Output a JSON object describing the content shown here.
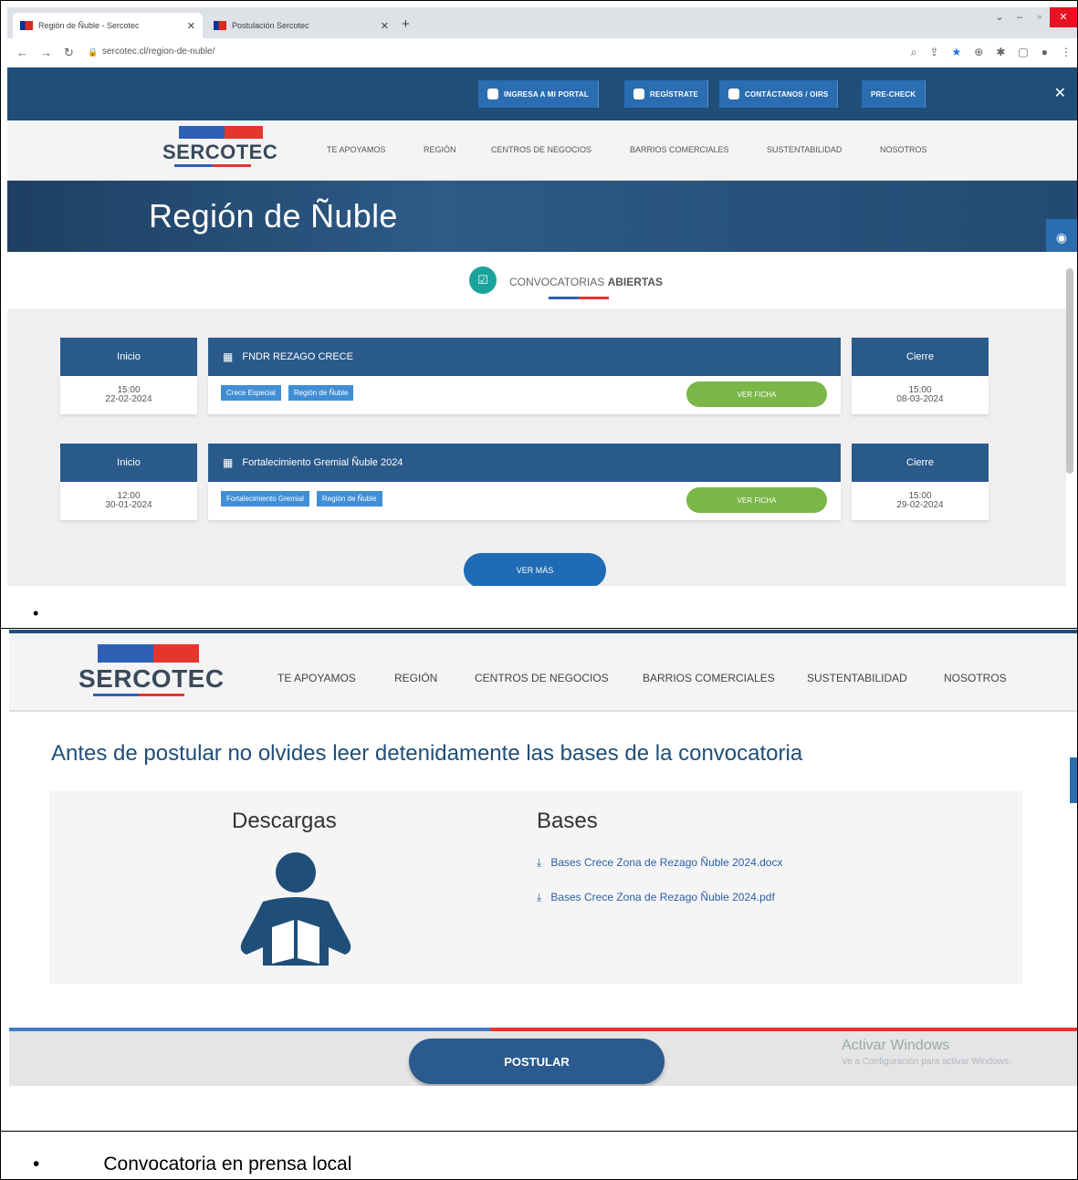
{
  "browser": {
    "tabs": [
      {
        "title": "Región de Ñuble - Sercotec"
      },
      {
        "title": "Postulación Sercotec"
      }
    ],
    "url": "sercotec.cl/region-de-nuble/"
  },
  "portal_bar": {
    "buttons": [
      "INGRESA A MI PORTAL",
      "REGÍSTRATE",
      "CONTÁCTANOS / OIRS",
      "PRE-CHECK"
    ]
  },
  "logo": {
    "text": "SERCOTEC"
  },
  "menu": {
    "items": [
      "TE APOYAMOS",
      "REGIÓN",
      "CENTROS DE NEGOCIOS",
      "BARRIOS COMERCIALES",
      "SUSTENTABILIDAD",
      "NOSOTROS"
    ]
  },
  "hero": {
    "title": "Región de Ñuble"
  },
  "convocatorias": {
    "label_prefix": "CONVOCATORIAS",
    "label_bold": "ABIERTAS",
    "start_header": "Inicio",
    "end_header": "Cierre",
    "view_label": "VER FICHA",
    "more_label": "VER MÁS",
    "items": [
      {
        "name": "FNDR REZAGO CRECE",
        "start_time": "15:00",
        "start_date": "22-02-2024",
        "tags": [
          "Crece Especial",
          "Región de Ñuble"
        ],
        "end_time": "15:00",
        "end_date": "08-03-2024"
      },
      {
        "name": "Fortalecimiento Gremial Ñuble 2024",
        "start_time": "12:00",
        "start_date": "30-01-2024",
        "tags": [
          "Fortalecimiento Gremial",
          "Región de Ñuble"
        ],
        "end_time": "15:00",
        "end_date": "29-02-2024"
      }
    ]
  },
  "postulacion": {
    "heading": "Antes de postular no olvides leer detenidamente las bases de la convocatoria",
    "descargas_title": "Descargas",
    "bases_title": "Bases",
    "files": [
      "Bases Crece Zona de Rezago Ñuble 2024.docx",
      "Bases Crece Zona de Rezago Ñuble 2024.pdf"
    ],
    "button": "POSTULAR",
    "watermark_title": "Activar Windows",
    "watermark_sub": "Ve a Configuración para activar Windows."
  },
  "doc": {
    "bullet_symbol": "•",
    "caption": "Convocatoria en prensa local"
  },
  "colors": {
    "navy": "#1f4e79",
    "blue": "#2a6db1",
    "green": "#7ab648",
    "red": "#e4362f",
    "teal": "#1aa39a"
  }
}
